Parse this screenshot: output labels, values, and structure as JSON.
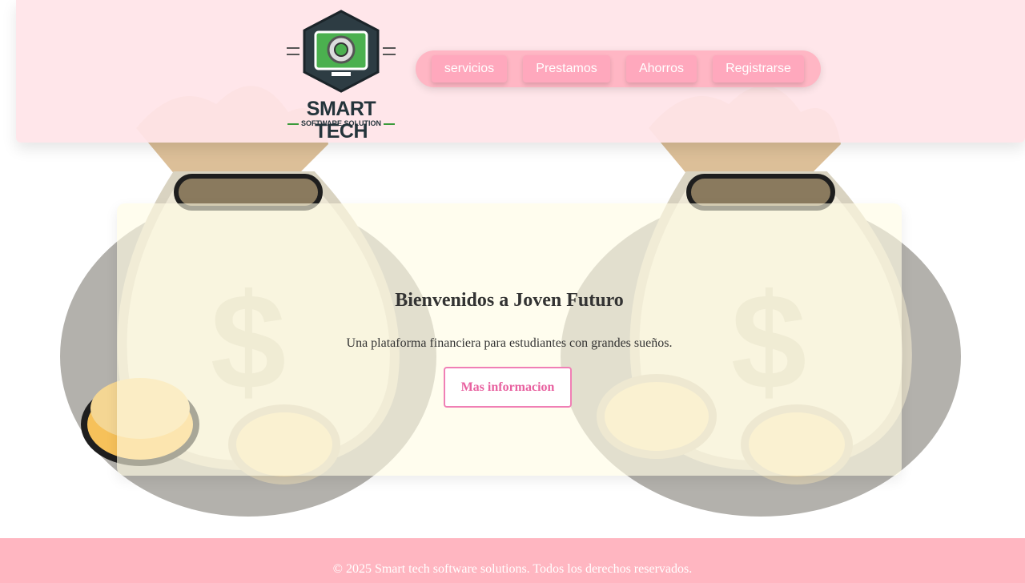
{
  "logo": {
    "name": "SMART TECH",
    "tagline": "SOFTWARE SOLUTION"
  },
  "nav": {
    "items": [
      "servicios",
      "Prestamos",
      "Ahorros",
      "Registrarse"
    ]
  },
  "hero": {
    "title": "Bienvenidos a Joven Futuro",
    "subtitle": "Una plataforma financiera para estudiantes con grandes sueños.",
    "button_label": "Mas informacion"
  },
  "footer": {
    "text": "© 2025 Smart tech software solutions. Todos los derechos reservados."
  },
  "colors": {
    "nav_pill": "#ffb6c4",
    "nav_button": "#ffa8bd",
    "accent": "#f07fb5",
    "footer": "#ffb6c1",
    "header": "#ffe4e8"
  }
}
